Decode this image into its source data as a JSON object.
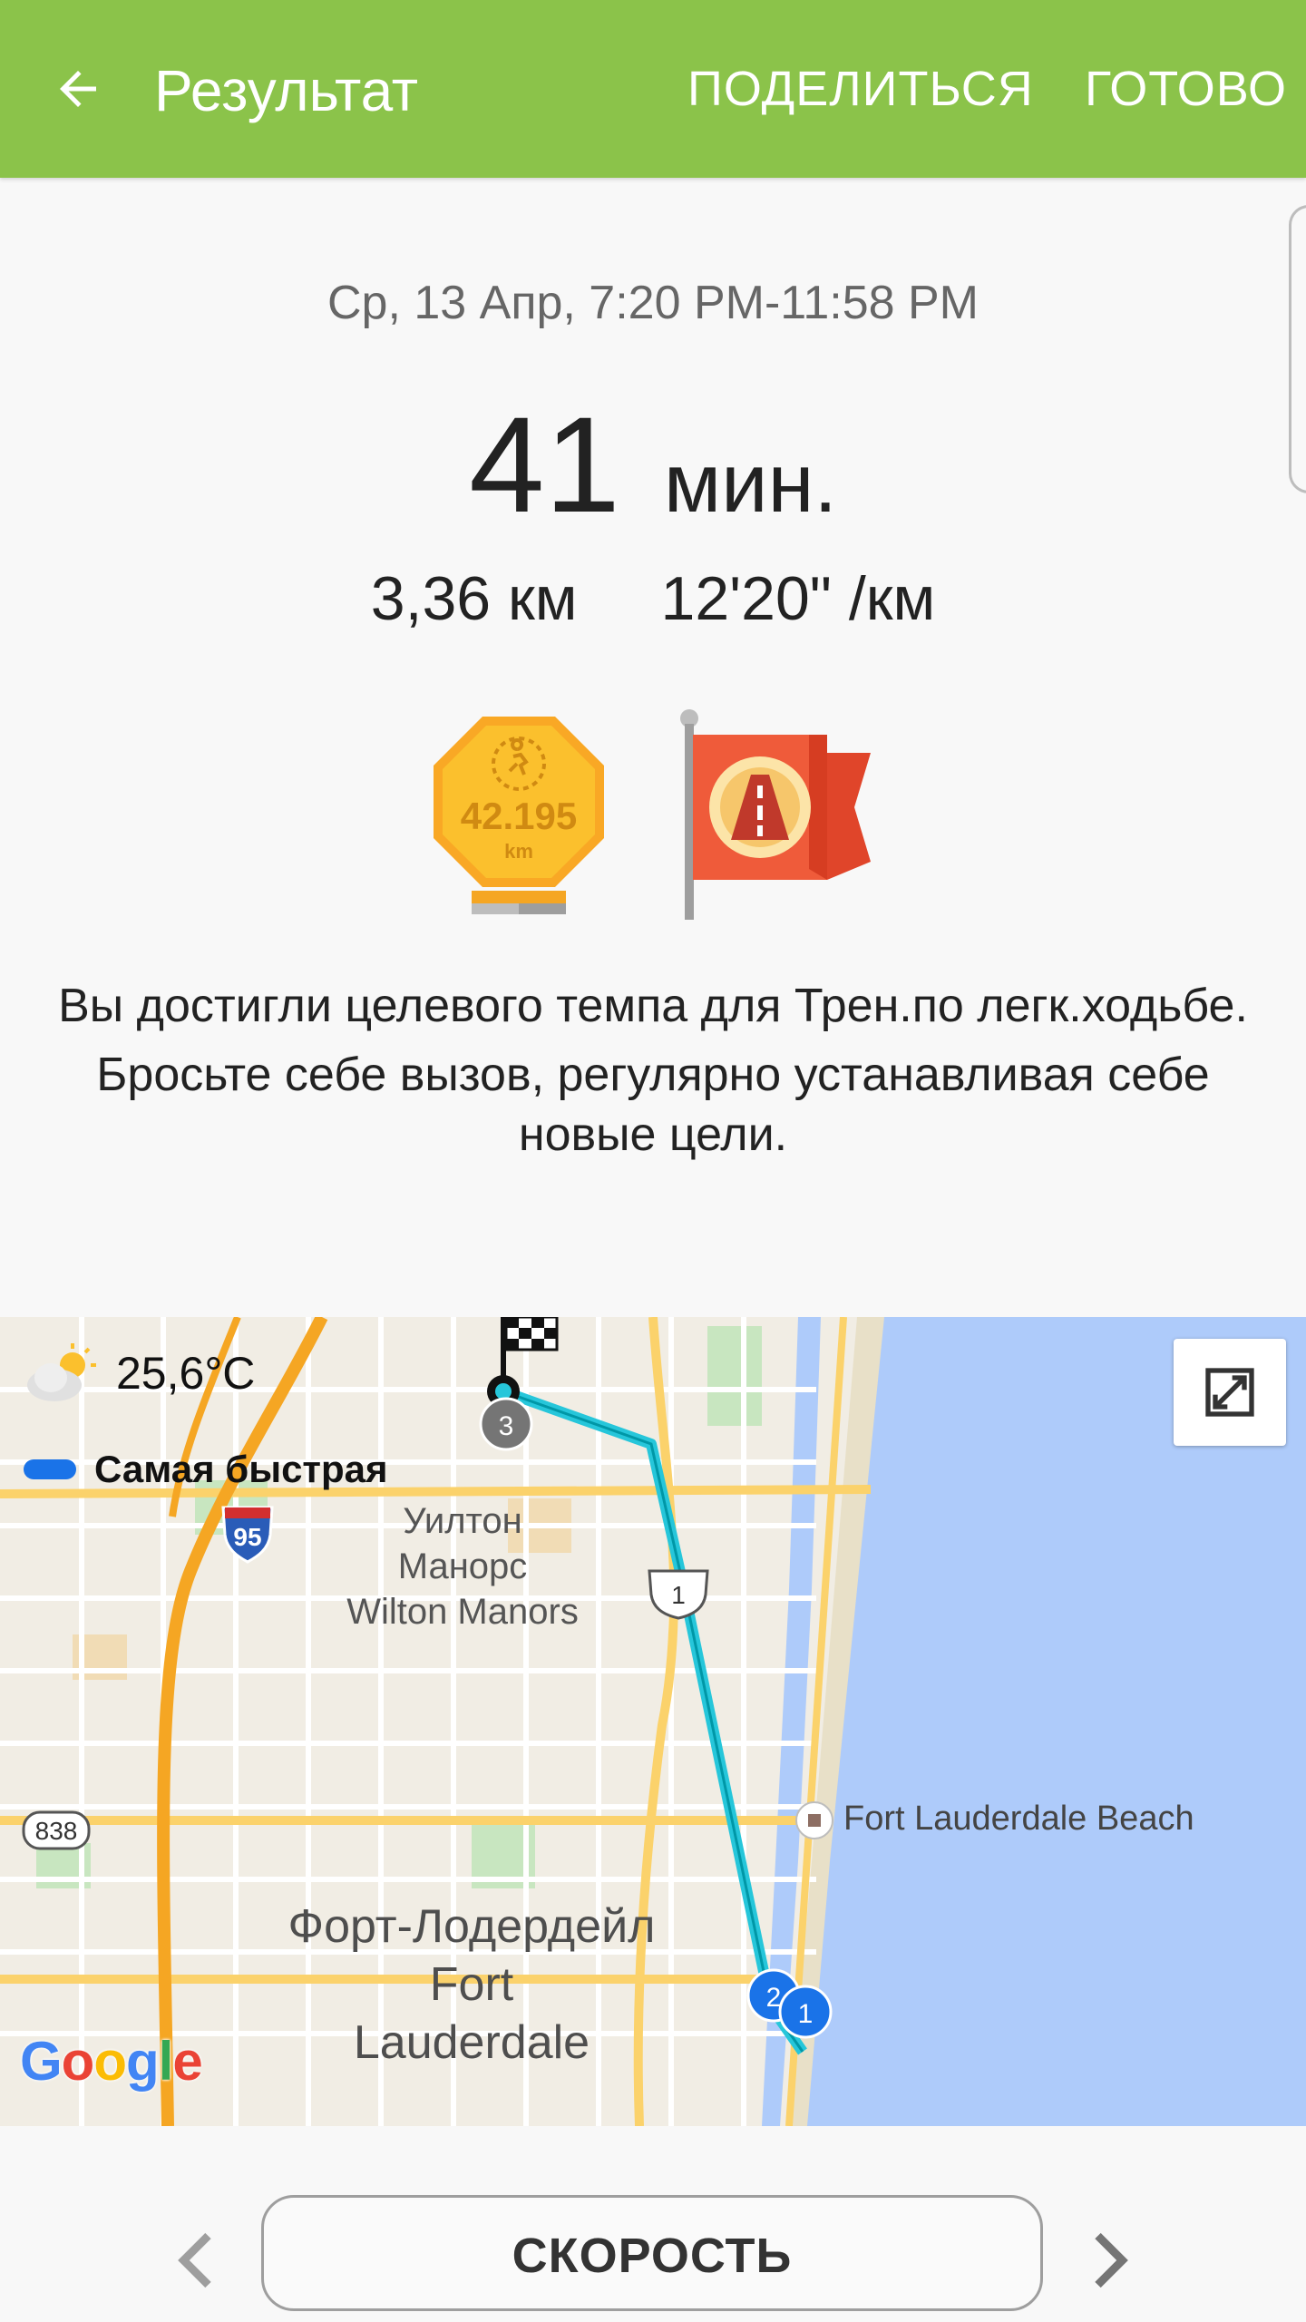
{
  "appbar": {
    "title": "Результат",
    "share_label": "ПОДЕЛИТЬСЯ",
    "done_label": "ГОТОВО"
  },
  "summary": {
    "date": "Ср, 13 Апр, 7:20 PM-11:58 PM",
    "duration_value": "41",
    "duration_unit": "мин.",
    "distance": "3,36 км",
    "pace": "12'20\" /км"
  },
  "badges": {
    "marathon_value": "42.195",
    "marathon_unit": "km"
  },
  "message": {
    "line1": "Вы достигли целевого темпа для Трен.по легк.ходьбе.",
    "line2": "Бросьте себе вызов, регулярно устанавливая себе новые цели."
  },
  "map": {
    "weather_temp": "25,6°C",
    "legend_label": "Самая быстрая",
    "place_wilton_ru": "Уилтон Манорс",
    "place_wilton_en": "Wilton Manors",
    "place_fortl_ru": "Форт-Лодердейл",
    "place_fortl_en": "Fort Lauderdale",
    "poi_beach": "Fort Lauderdale Beach",
    "shield_95": "95",
    "shield_1": "1",
    "shield_838": "838",
    "marker_1": "1",
    "marker_2": "2",
    "marker_3": "3",
    "logo_text": "Google",
    "route_color": "#26c6da",
    "water_color": "#aecbfa"
  },
  "bottom": {
    "metric_button": "СКОРОСТЬ"
  },
  "colors": {
    "appbar": "#8bc34a",
    "accent_route": "#26c6da",
    "marker_blue": "#1a73e8"
  }
}
